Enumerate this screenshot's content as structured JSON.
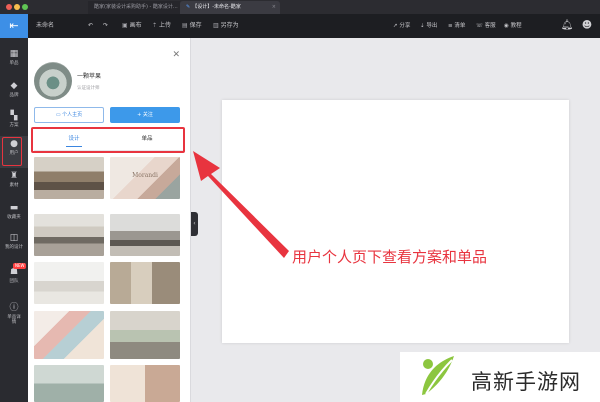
{
  "window": {
    "tabs": [
      {
        "label": "酷家(家装设计采购助手) - 酷家设计..."
      },
      {
        "label": "【设计】-未命名-酷家"
      }
    ]
  },
  "toolbar": {
    "doc_name": "未命名",
    "gallery": "画布",
    "upload": "上传",
    "save": "保存",
    "save_as": "另存为",
    "share": "分享",
    "export": "导出",
    "list": "清单",
    "service": "客服",
    "tutorial": "教程"
  },
  "sidebar": {
    "items": [
      {
        "label": "单品",
        "icon": "box-icon"
      },
      {
        "label": "品牌",
        "icon": "tag-icon"
      },
      {
        "label": "方案",
        "icon": "layout-icon"
      },
      {
        "label": "用户",
        "icon": "user-icon"
      },
      {
        "label": "素材",
        "icon": "material-icon"
      },
      {
        "label": "收藏夹",
        "icon": "folder-icon"
      },
      {
        "label": "我的设计",
        "icon": "design-icon"
      },
      {
        "label": "团队",
        "icon": "team-icon"
      },
      {
        "label": "单品详情",
        "icon": "info-icon"
      }
    ],
    "new_badge": "NEW"
  },
  "user_panel": {
    "name": "一颗苹果",
    "subtitle": "认证设计师",
    "home_button": "个人主页",
    "follow_button": "关注",
    "tabs": [
      "设计",
      "单品"
    ],
    "active_tab": "设计"
  },
  "thumbnails": [
    {
      "caption": ""
    },
    {
      "caption": "Morandi"
    },
    {
      "caption": ""
    },
    {
      "caption": ""
    },
    {
      "caption": ""
    },
    {
      "caption": ""
    },
    {
      "caption": ""
    },
    {
      "caption": ""
    },
    {
      "caption": ""
    },
    {
      "caption": ""
    }
  ],
  "annotation": "用户个人页下查看方案和单品",
  "watermark": "高新手游网",
  "colors": {
    "accent": "#3d8fe6",
    "highlight_red": "#e8343f",
    "toolbar_bg": "#1d1e22",
    "sidebar_bg": "#2a2b30",
    "watermark_leaf": "#8cc63f"
  }
}
